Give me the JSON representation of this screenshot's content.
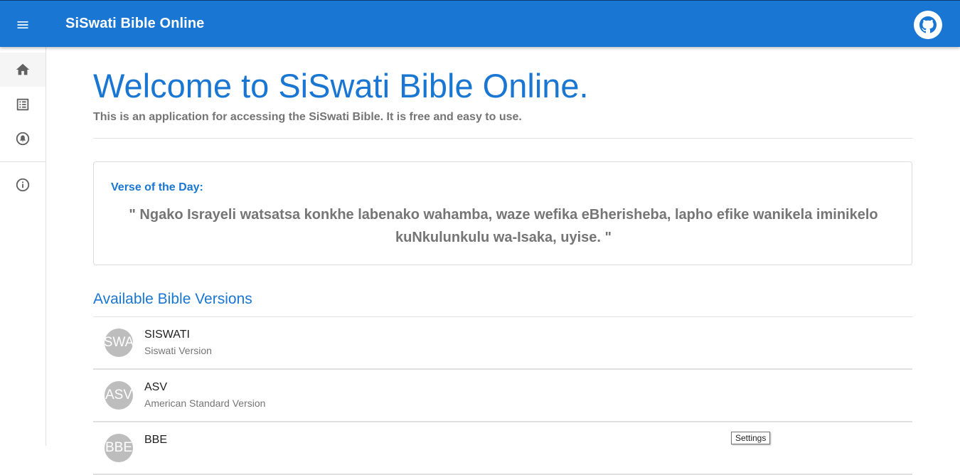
{
  "header": {
    "title": "SiSwati Bible Online",
    "menu_icon": "menu-icon",
    "github_icon": "github-icon",
    "color": "#1976d2"
  },
  "sidebar": {
    "items": [
      {
        "icon": "home-icon",
        "active": true
      },
      {
        "icon": "list-icon",
        "active": false
      },
      {
        "icon": "alarm-bell-icon",
        "active": false
      },
      {
        "icon": "info-icon",
        "active": false
      }
    ]
  },
  "main": {
    "welcome": "Welcome to SiSwati Bible Online.",
    "subtitle": "This is an application for accessing the SiSwati Bible. It is free and easy to use.",
    "verse_label": "Verse of the Day:",
    "verse_text": "\" Ngako Israyeli watsatsa konkhe labenako wahamba, waze wefika eBherisheba, lapho efike wanikela iminikelo kuNkulunkulu wa-Isaka, uyise. \"",
    "versions_title": "Available Bible Versions",
    "versions": [
      {
        "avatar": "SWA",
        "name": "SISWATI",
        "description": "Siswati Version"
      },
      {
        "avatar": "ASV",
        "name": "ASV",
        "description": "American Standard Version"
      },
      {
        "avatar": "BBE",
        "name": "BBE",
        "description": ""
      }
    ]
  },
  "tooltip": "Settings"
}
